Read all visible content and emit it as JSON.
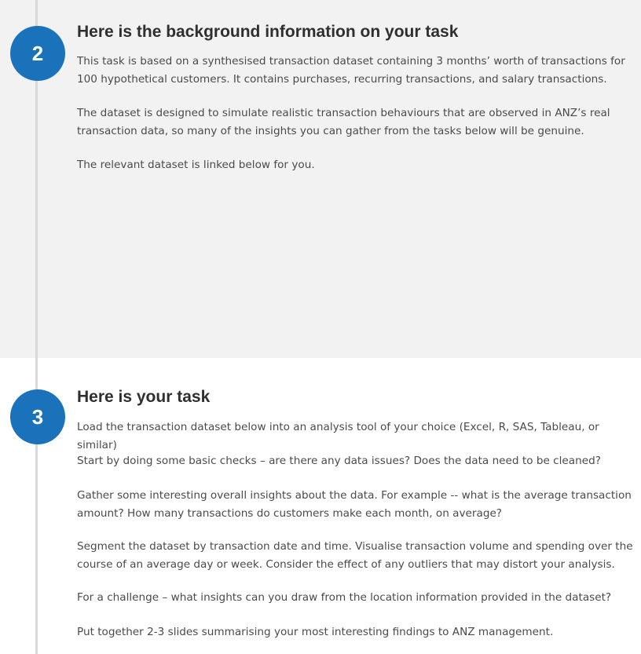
{
  "steps": [
    {
      "number": "2",
      "title": "Here is the background information on your task",
      "paragraphs": [
        "This task is based on a synthesised transaction dataset containing 3 months’ worth of transactions for 100 hypothetical customers. It contains purchases, recurring transactions, and salary transactions.",
        "The dataset is designed to simulate realistic transaction behaviours that are observed in ANZ’s real transaction data, so many of the insights you can gather from the tasks below will be genuine.",
        "The relevant dataset is linked below for you."
      ]
    },
    {
      "number": "3",
      "title": "Here is your task",
      "paragraphs": [
        "Load the transaction dataset below into an analysis tool of your choice (Excel, R, SAS, Tableau, or similar)",
        "Start by doing some basic checks – are there any data issues? Does the data need to be cleaned?",
        "Gather some interesting overall insights about the data. For example -- what is the average transaction amount? How many transactions do customers make each month, on average?",
        "Segment the dataset by transaction date and time. Visualise transaction volume and spending over the course of an average day or week. Consider the effect of any outliers that may distort your analysis.",
        "For a challenge – what insights can you draw from the location information provided in the dataset?",
        "Put together 2-3 slides summarising your most interesting findings to ANZ management."
      ]
    }
  ],
  "colors": {
    "step_circle": "#1a73ba",
    "section_bg_gray": "#f2f2f2",
    "timeline_line": "#d9d9d9"
  }
}
